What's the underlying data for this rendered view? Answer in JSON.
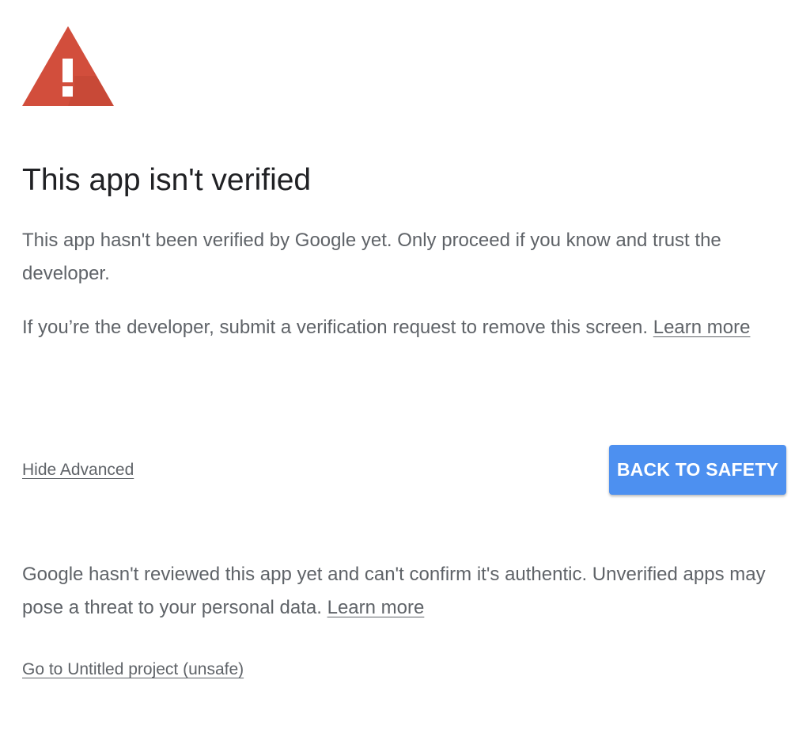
{
  "warning": {
    "icon": "warning-triangle-icon",
    "color": "#d24e3c"
  },
  "title": "This app isn't verified",
  "paragraph1": {
    "text": "This app hasn't been verified by Google yet. Only proceed if you know and trust the developer."
  },
  "paragraph2": {
    "text": "If you’re the developer, submit a verification request to remove this screen. ",
    "link": "Learn more"
  },
  "actions": {
    "hide_advanced": "Hide Advanced",
    "back_to_safety": "BACK TO SAFETY",
    "button_color": "#4d90f0"
  },
  "paragraph3": {
    "text": "Google hasn't reviewed this app yet and can't confirm it's authentic. Unverified apps may pose a threat to your personal data. ",
    "link": "Learn more"
  },
  "proceed_link": "Go to Untitled project (unsafe)"
}
